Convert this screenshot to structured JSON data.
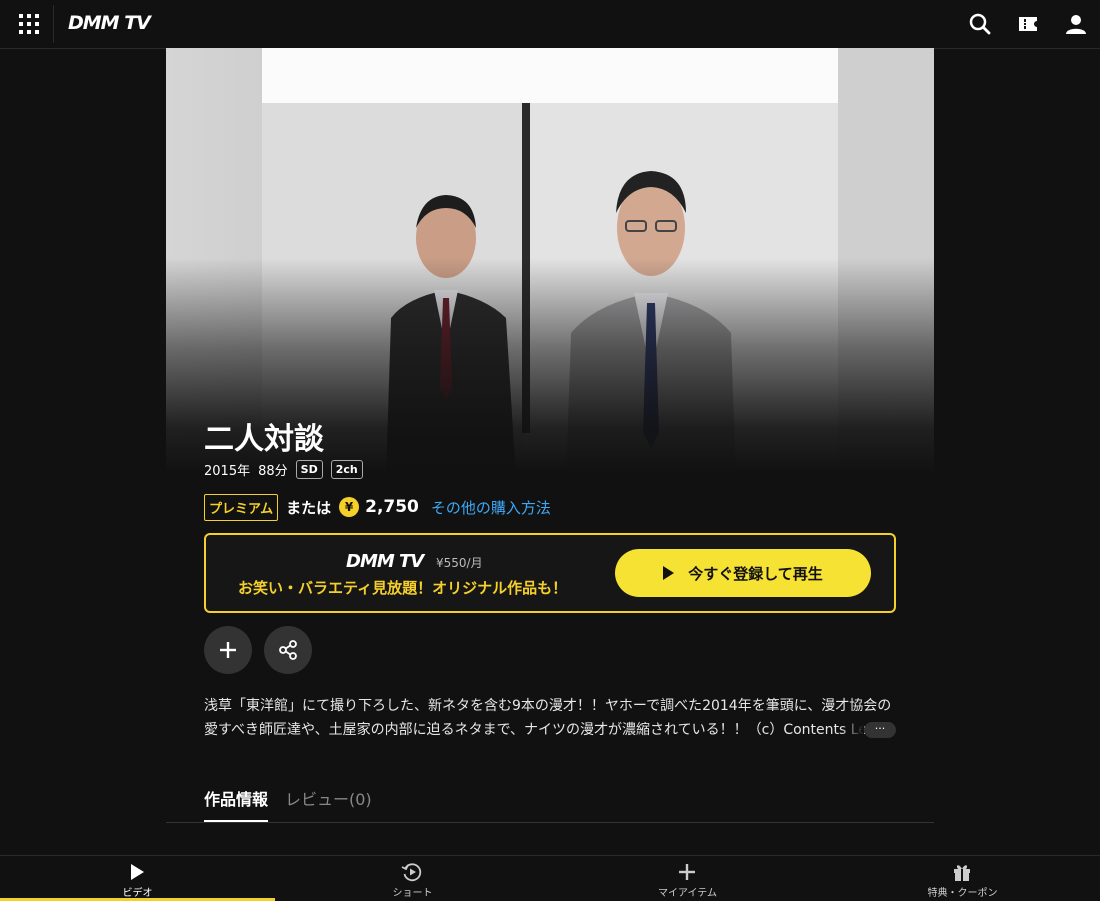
{
  "header": {
    "logo": "DMM TV",
    "icons": [
      "grid-menu-icon",
      "search-icon",
      "ticket-icon",
      "user-icon"
    ]
  },
  "title": {
    "name": "二人対談",
    "year": "2015年",
    "duration": "88分",
    "quality": "SD",
    "audio": "2ch"
  },
  "price": {
    "premium_label": "プレミアム",
    "or_label": "または",
    "yen_symbol": "¥",
    "amount": "2,750",
    "other_methods": "その他の購入方法"
  },
  "promo": {
    "logo": "DMM TV",
    "monthly_price": "¥550/月",
    "copy": "お笑い・バラエティ見放題！オリジナル作品も！",
    "play_label": "今すぐ登録して再生"
  },
  "actions": {
    "add_icon": "plus-icon",
    "share_icon": "share-icon"
  },
  "description": "浅草「東洋館」にて撮り下ろした、新ネタを含む9本の漫才！！ヤホーで調べた2014年を筆頭に、漫才協会の愛すべき師匠達や、土屋家の内部に迫るネタまで、ナイツの漫才が濃縮されている！！（c）Contents Le",
  "more_label": "···",
  "tabs": [
    {
      "label": "作品情報",
      "active": true
    },
    {
      "label": "レビュー(0)",
      "active": false
    }
  ],
  "bottom_nav": [
    {
      "label": "ビデオ",
      "icon": "play-icon",
      "active": true
    },
    {
      "label": "ショート",
      "icon": "short-video-icon",
      "active": false
    },
    {
      "label": "マイアイテム",
      "icon": "plus-icon",
      "active": false
    },
    {
      "label": "特典・クーポン",
      "icon": "gift-icon",
      "active": false
    }
  ],
  "colors": {
    "accent": "#f5d02b",
    "button_yellow": "#f5e232",
    "link": "#3ea8f5",
    "background": "#111111"
  }
}
